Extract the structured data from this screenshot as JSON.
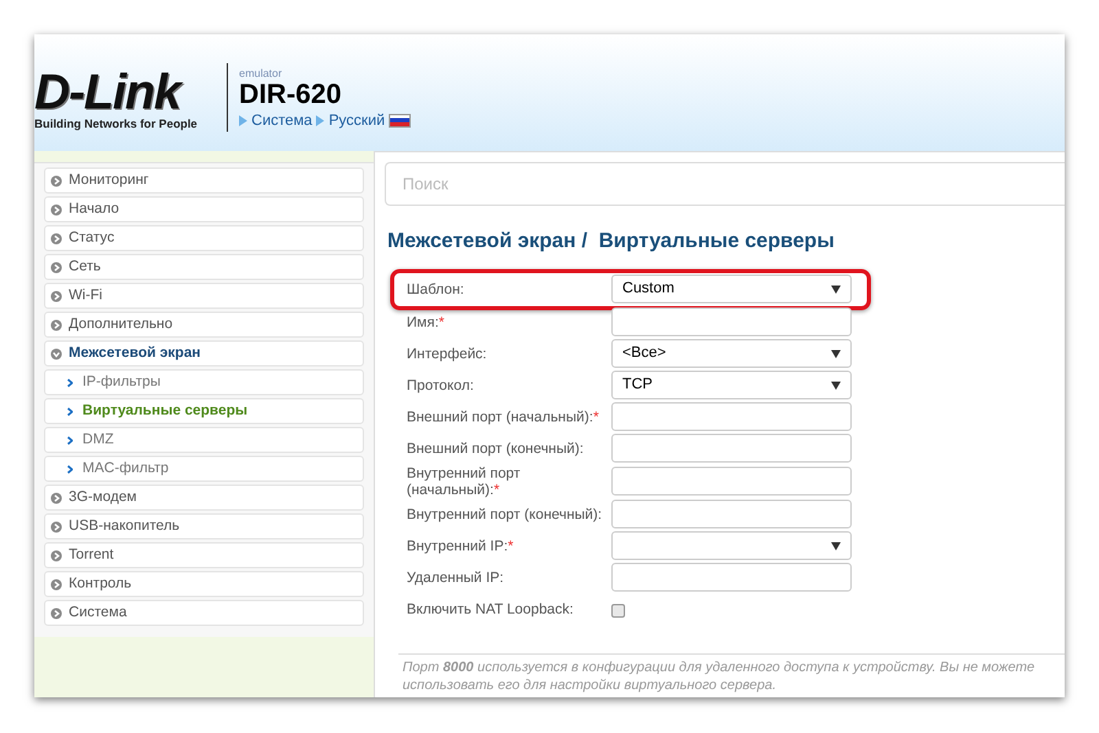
{
  "header": {
    "brand": "D-Link",
    "tagline": "Building Networks for People",
    "emulator_label": "emulator",
    "model": "DIR-620",
    "breadcrumbs": [
      "Система",
      "Русский"
    ]
  },
  "sidebar": {
    "items": [
      {
        "label": "Мониторинг",
        "expanded": false
      },
      {
        "label": "Начало",
        "expanded": false
      },
      {
        "label": "Статус",
        "expanded": false
      },
      {
        "label": "Сеть",
        "expanded": false
      },
      {
        "label": "Wi-Fi",
        "expanded": false
      },
      {
        "label": "Дополнительно",
        "expanded": false
      },
      {
        "label": "Межсетевой экран",
        "expanded": true,
        "children": [
          {
            "label": "IP-фильтры",
            "selected": false
          },
          {
            "label": "Виртуальные серверы",
            "selected": true
          },
          {
            "label": "DMZ",
            "selected": false
          },
          {
            "label": "MAC-фильтр",
            "selected": false
          }
        ]
      },
      {
        "label": "3G-модем",
        "expanded": false
      },
      {
        "label": "USB-накопитель",
        "expanded": false
      },
      {
        "label": "Torrent",
        "expanded": false
      },
      {
        "label": "Контроль",
        "expanded": false
      },
      {
        "label": "Система",
        "expanded": false
      }
    ]
  },
  "search": {
    "placeholder": "Поиск"
  },
  "page_title": "Межсетевой экран /  Виртуальные серверы",
  "form": [
    {
      "kind": "select",
      "label": "Шаблон:",
      "value": "Custom",
      "highlighted": true
    },
    {
      "kind": "text",
      "label": "Имя:",
      "required_mark": "*",
      "highlighted": false
    },
    {
      "kind": "select",
      "label": "Интерфейс:",
      "value": "<Все>",
      "highlighted": false
    },
    {
      "kind": "select",
      "label": "Протокол:",
      "value": "TCP",
      "highlighted": false
    },
    {
      "kind": "text",
      "label": "Внешний порт (начальный):",
      "required_mark": "*",
      "highlighted": false
    },
    {
      "kind": "text",
      "label": "Внешний порт (конечный):",
      "highlighted": false
    },
    {
      "kind": "text",
      "label": "Внутренний порт (начальный):",
      "required_mark": "*",
      "highlighted": false
    },
    {
      "kind": "text",
      "label": "Внутренний порт (конечный):",
      "highlighted": false
    },
    {
      "kind": "select",
      "label": "Внутренний IP:",
      "required_mark": "*",
      "highlighted": false
    },
    {
      "kind": "text",
      "label": "Удаленный IP:",
      "highlighted": false
    },
    {
      "kind": "checkbox",
      "label": "Включить NAT Loopback:",
      "checked": false,
      "highlighted": false
    }
  ],
  "note": "Порт **8000** используется в конфигурации для удаленного доступа к устройству. Вы не можете использовать его для настройки виртуального сервера."
}
